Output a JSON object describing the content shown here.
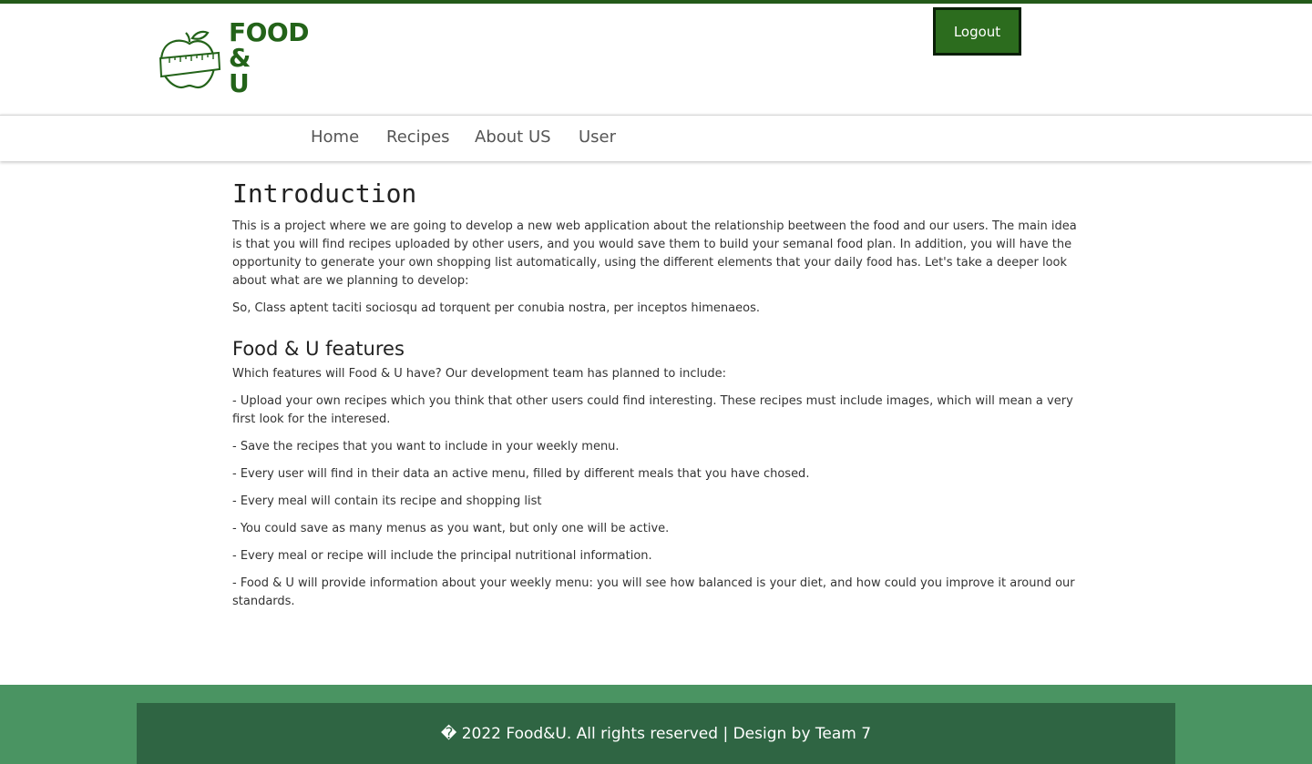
{
  "brand": {
    "logo_line1": "FOOD",
    "logo_line2": "&",
    "logo_line3": "U",
    "color": "#236319"
  },
  "header": {
    "logout_label": "Logout"
  },
  "nav": {
    "items": [
      {
        "label": "Home"
      },
      {
        "label": "Recipes"
      },
      {
        "label": "About US"
      },
      {
        "label": "User"
      }
    ]
  },
  "intro": {
    "title": "Introduction",
    "paragraph1": "This is a project where we are going to develop a new web application about the relationship beetween the food and our users. The main idea is that you will find recipes uploaded by other users, and you would save them to build your semanal food plan. In addition, you will have the opportunity to generate your own shopping list automatically, using the different elements that your daily food has. Let's take a deeper look about what are we planning to develop:",
    "paragraph2": "So, Class aptent taciti sociosqu ad torquent per conubia nostra, per inceptos himenaeos."
  },
  "features": {
    "title": "Food & U features",
    "lead": "Which features will Food & U have? Our development team has planned to include:",
    "items": [
      "- Upload your own recipes which you think that other users could find interesting. These recipes must include images, which will mean a very first look for the interesed.",
      "- Save the recipes that you want to include in your weekly menu.",
      "- Every user will find in their data an active menu, filled by different meals that you have chosed.",
      "- Every meal will contain its recipe and shopping list",
      "- You could save as many menus as you want, but only one will be active.",
      "- Every meal or recipe will include the principal nutritional information.",
      "- Food & U will provide information about your weekly menu: you will see how balanced is your diet, and how could you improve it around our standards."
    ]
  },
  "footer": {
    "text": "� 2022 Food&U. All rights reserved | Design by Team 7"
  },
  "colors": {
    "accent": "#2c6c1e",
    "footer_outer": "#4a9462",
    "footer_inner": "#2f6543"
  }
}
